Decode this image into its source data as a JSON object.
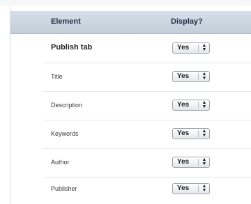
{
  "table": {
    "headers": {
      "element": "Element",
      "display": "Display?"
    },
    "rows": [
      {
        "label": "Publish tab",
        "display": "Yes"
      },
      {
        "label": "Title",
        "display": "Yes"
      },
      {
        "label": "Description",
        "display": "Yes"
      },
      {
        "label": "Keywords",
        "display": "Yes"
      },
      {
        "label": "Author",
        "display": "Yes"
      },
      {
        "label": "Publisher",
        "display": "Yes"
      }
    ]
  },
  "icons": {
    "select_arrows": "updown-arrows-icon"
  },
  "colors": {
    "header_bg": "#c9d4de",
    "header_text": "#1f2f44"
  }
}
